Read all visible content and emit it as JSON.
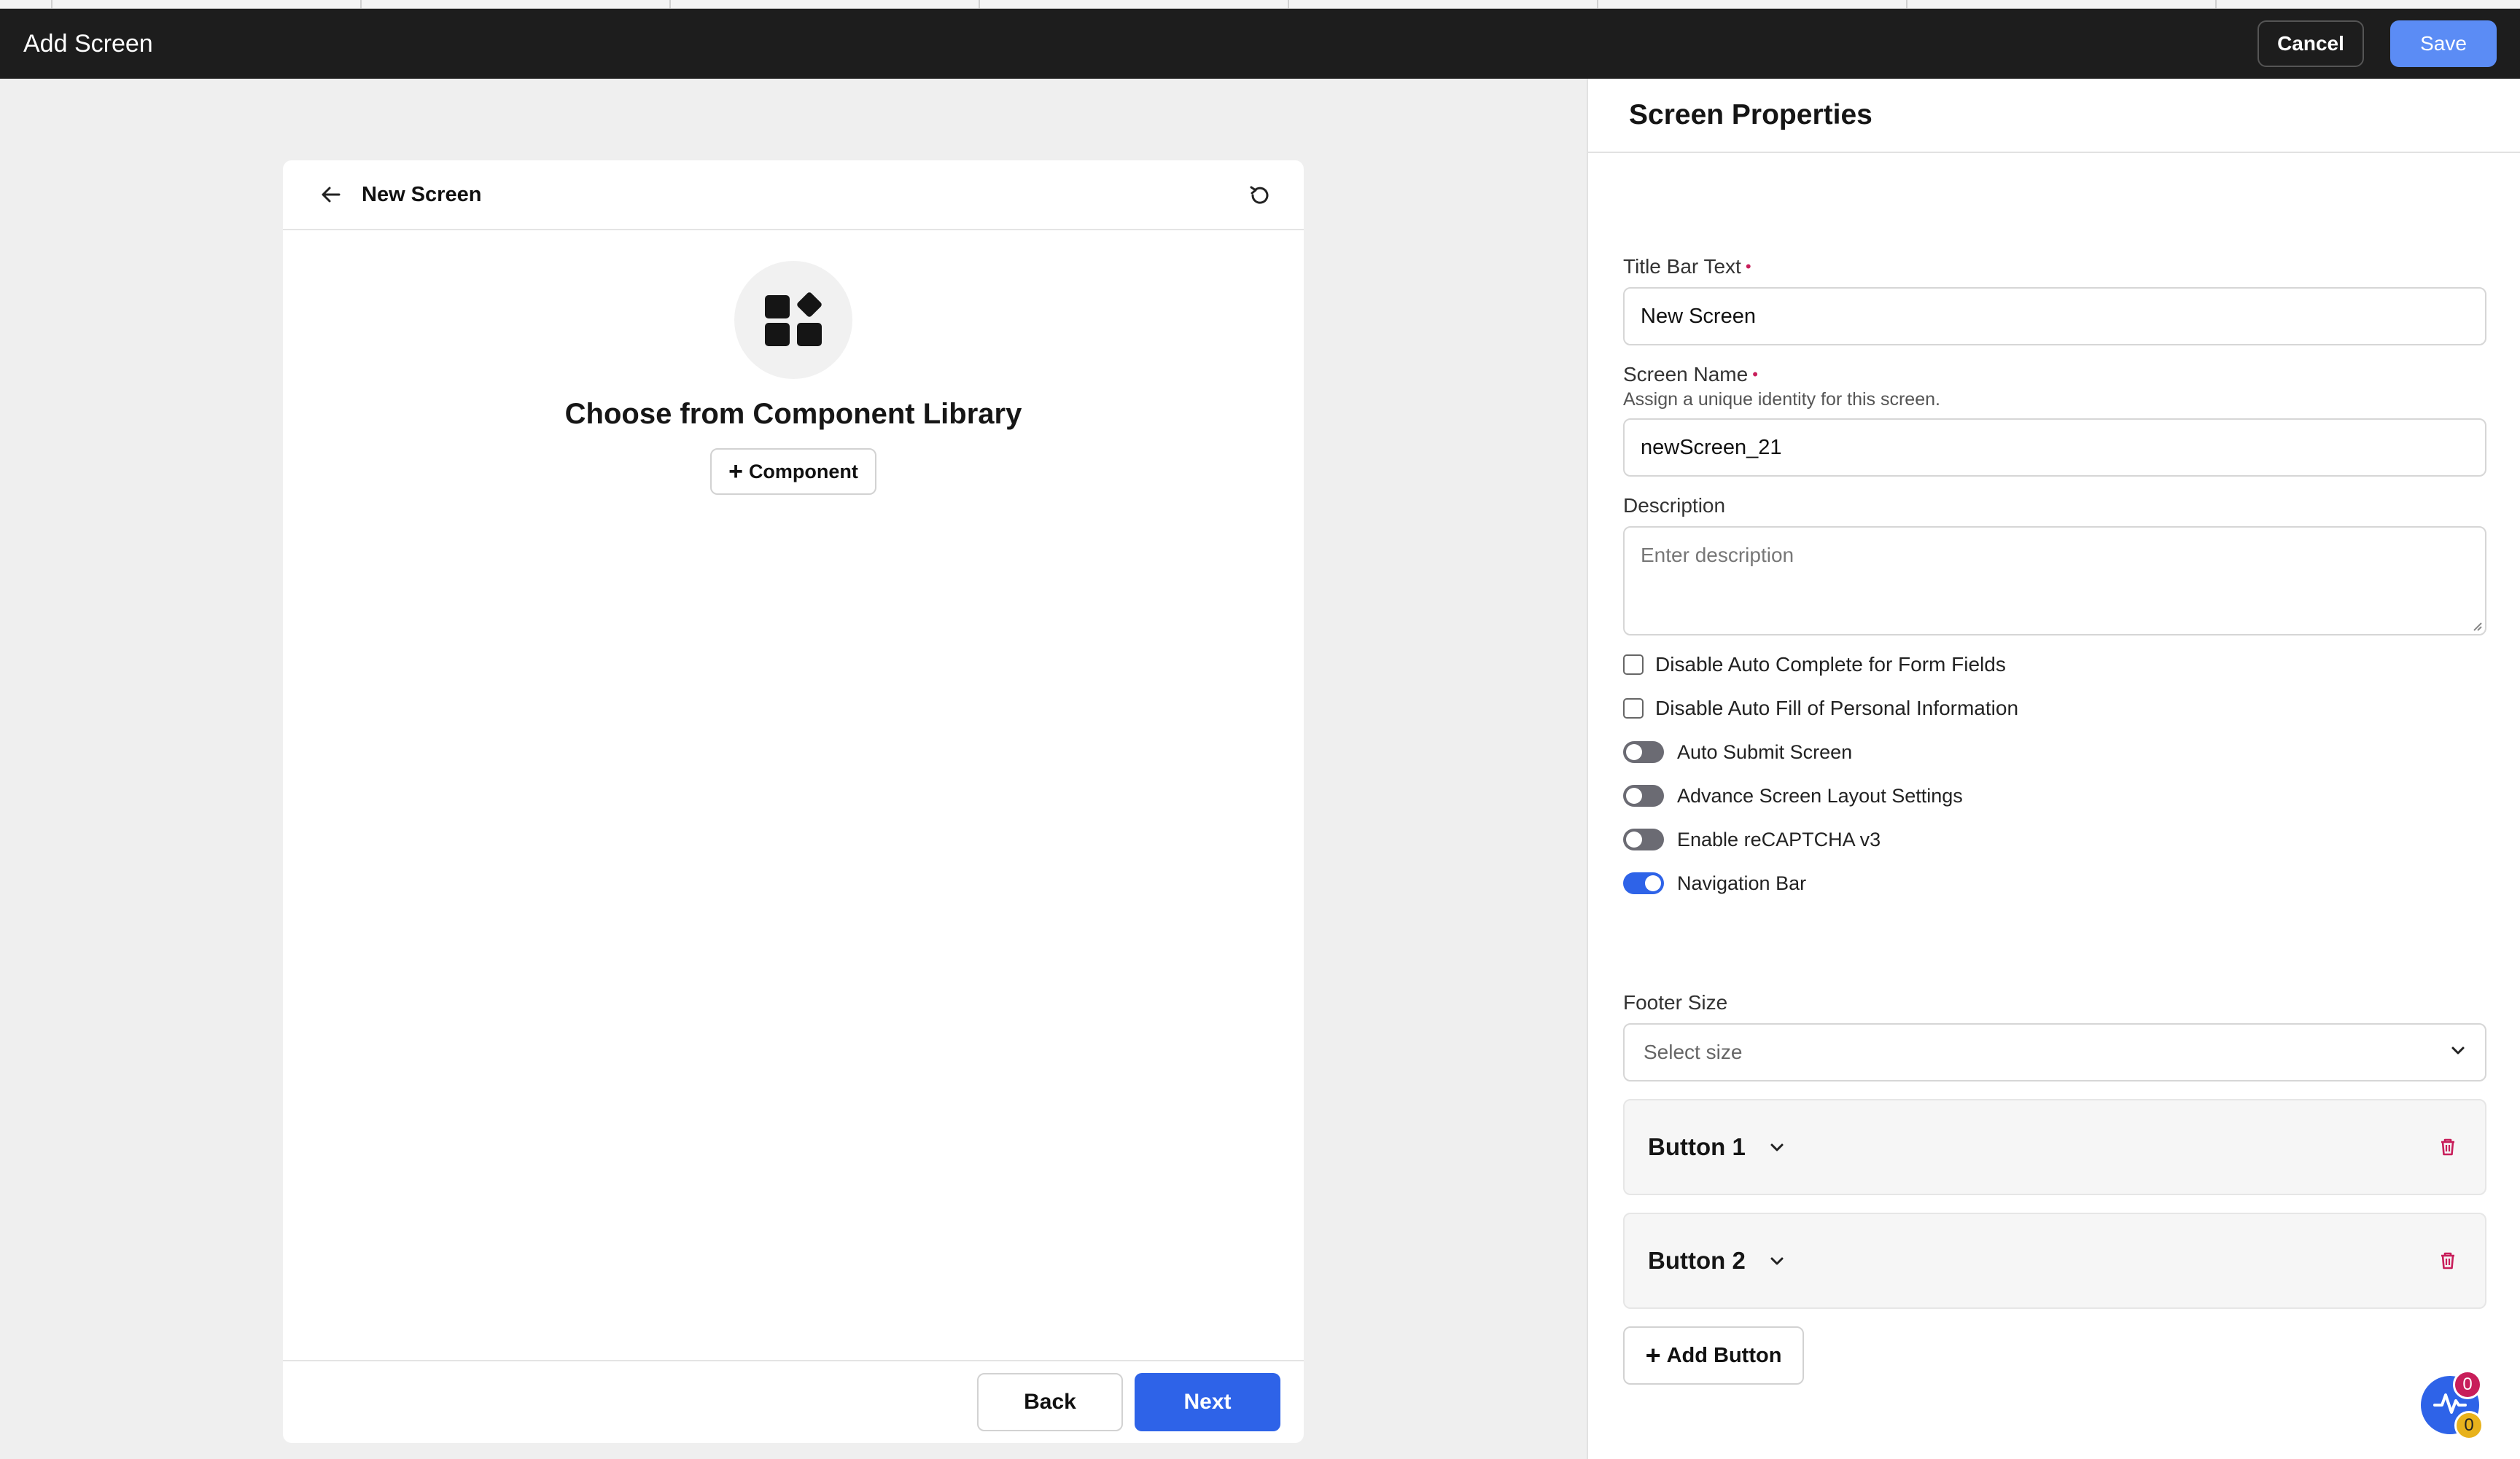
{
  "topbar": {
    "title": "Add Screen",
    "cancel_label": "Cancel",
    "save_label": "Save"
  },
  "preview": {
    "title": "New Screen",
    "empty_title": "Choose from Component Library",
    "component_button": "Component",
    "back_label": "Back",
    "next_label": "Next",
    "icons": [
      "back-arrow-icon",
      "refresh-icon",
      "component-library-icon",
      "plus-icon"
    ]
  },
  "panel": {
    "title": "Screen Properties",
    "title_bar_text": {
      "label": "Title Bar Text",
      "value": "New Screen"
    },
    "screen_name": {
      "label": "Screen Name",
      "help": "Assign a unique identity for this screen.",
      "value": "newScreen_21"
    },
    "description": {
      "label": "Description",
      "placeholder": "Enter description"
    },
    "checkboxes": [
      {
        "label": "Disable Auto Complete for Form Fields",
        "checked": false
      },
      {
        "label": "Disable Auto Fill of Personal Information",
        "checked": false
      }
    ],
    "toggles": [
      {
        "label": "Auto Submit Screen",
        "on": false
      },
      {
        "label": "Advance Screen Layout Settings",
        "on": false
      },
      {
        "label": "Enable reCAPTCHA v3",
        "on": false
      },
      {
        "label": "Navigation Bar",
        "on": true
      }
    ],
    "footer_size": {
      "label": "Footer Size",
      "placeholder": "Select size"
    },
    "buttons": [
      {
        "label": "Button 1"
      },
      {
        "label": "Button 2"
      }
    ],
    "add_button_label": "Add Button"
  },
  "fab": {
    "badge_top": "0",
    "badge_bottom": "0"
  },
  "colors": {
    "primary": "#2e63e8",
    "save": "#5b8cf5",
    "topbar": "#1d1d1d",
    "danger": "#c81e5a",
    "warning": "#e8b21c"
  }
}
